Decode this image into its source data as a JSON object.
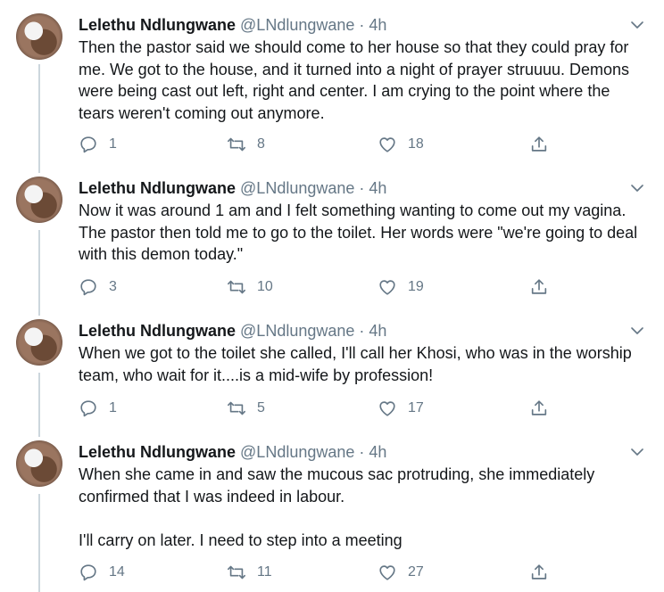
{
  "tweets": [
    {
      "name": "Lelethu Ndlungwane",
      "handle": "@LNdlungwane",
      "separator": "·",
      "time": "4h",
      "paragraphs": [
        "Then the pastor  said we should come to her house so that they could pray for me. We got to the house, and it turned into a night of prayer struuuu. Demons were being cast out left, right and center. I am crying to the point where the tears weren't coming out anymore."
      ],
      "replies": "1",
      "retweets": "8",
      "likes": "18"
    },
    {
      "name": "Lelethu Ndlungwane",
      "handle": "@LNdlungwane",
      "separator": "·",
      "time": "4h",
      "paragraphs": [
        "Now it was around 1 am and I felt something wanting to come out my vagina. The pastor then told me to go to the toilet. Her words were \"we're going to deal with this demon today.\""
      ],
      "replies": "3",
      "retweets": "10",
      "likes": "19"
    },
    {
      "name": "Lelethu Ndlungwane",
      "handle": "@LNdlungwane",
      "separator": "·",
      "time": "4h",
      "paragraphs": [
        "When we got to the toilet she called, I'll call her Khosi, who was in the worship team, who wait for it....is a mid-wife by profession!"
      ],
      "replies": "1",
      "retweets": "5",
      "likes": "17"
    },
    {
      "name": "Lelethu Ndlungwane",
      "handle": "@LNdlungwane",
      "separator": "·",
      "time": "4h",
      "paragraphs": [
        "When she came in and saw the mucous sac protruding, she immediately confirmed that I was indeed in labour.",
        "I'll carry on later. I need to step into a meeting"
      ],
      "replies": "14",
      "retweets": "11",
      "likes": "27"
    }
  ],
  "icons": {
    "reply": "reply-icon",
    "retweet": "retweet-icon",
    "like": "like-icon",
    "share": "share-icon",
    "caret": "chevron-down-icon"
  },
  "colors": {
    "text": "#14171a",
    "secondary": "#657786",
    "thread_line": "#ccd6dd",
    "divider": "#e6ecf0"
  }
}
